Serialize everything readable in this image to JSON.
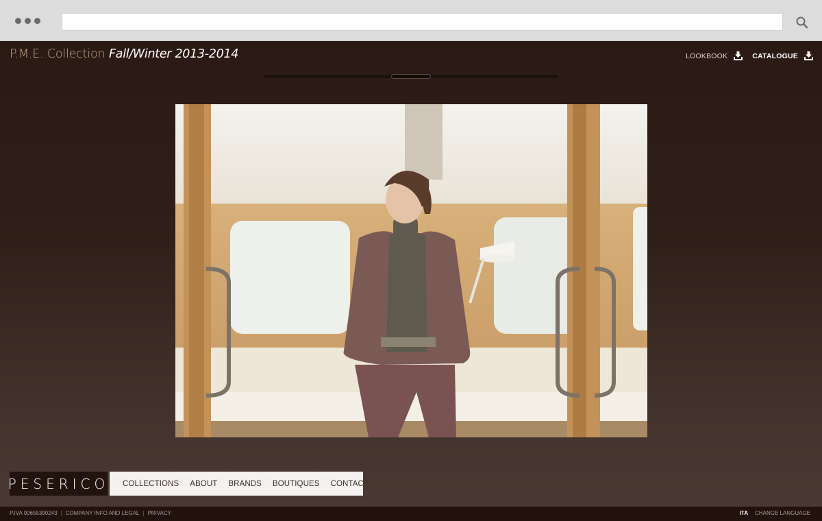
{
  "browser": {
    "url": "",
    "icons": {
      "menu": "three-dots-icon",
      "search": "magnifier-icon"
    }
  },
  "header": {
    "brand": "P.M.E. Collection",
    "season": "Fall/Winter 2013-2014",
    "lookbook_label": "LOOKBOOK",
    "catalogue_label": "CATALOGUE"
  },
  "slider": {
    "position_fraction": 0.5
  },
  "photo": {
    "alt": "model"
  },
  "footer": {
    "logo": "PESERICO",
    "nav": [
      "COLLECTIONS",
      "ABOUT",
      "BRANDS",
      "BOUTIQUES",
      "CONTACT"
    ],
    "legal": [
      "P.IVA 00655390243",
      "COMPANY INFO AND LEGAL",
      "PRIVACY"
    ],
    "language_current": "ITA",
    "language_change": "CHANGE LANGUAGE"
  },
  "colors": {
    "page_bg_top": "#2b1a14",
    "page_bg_bottom": "#4a3a33",
    "brand_accent": "#c2ab8e",
    "footer_bar": "#21120c"
  }
}
